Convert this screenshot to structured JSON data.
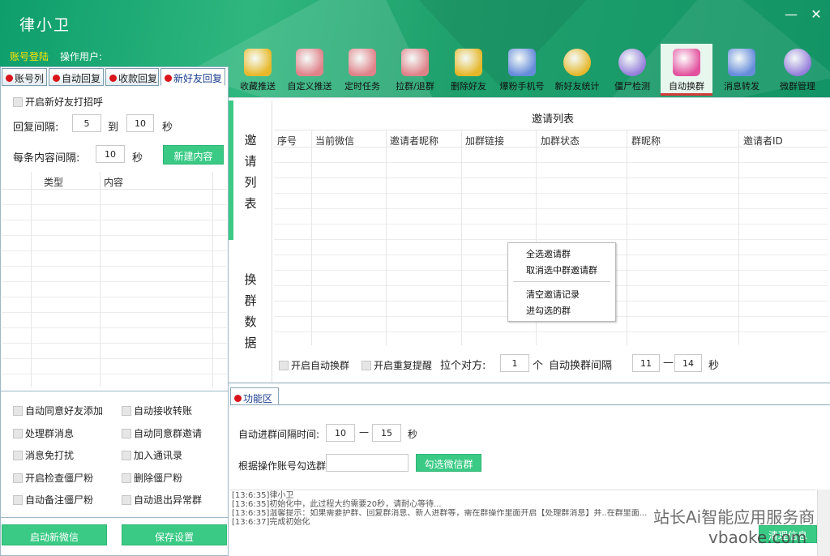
{
  "app": {
    "title": "律小卫",
    "minimize_icon": "minimize-icon",
    "close_icon": "close-icon"
  },
  "header": {
    "login_label": "账号登陆",
    "operator_label": "操作用户:"
  },
  "toolbar": [
    {
      "name": "toolbar-collect-push",
      "label": "收藏推送",
      "icon": "folder-star-icon",
      "color": "#f0b826"
    },
    {
      "name": "toolbar-custom-push",
      "label": "自定义推送",
      "icon": "document-icon",
      "color": "#e8808a"
    },
    {
      "name": "toolbar-scheduled-task",
      "label": "定时任务",
      "icon": "cup-icon",
      "color": "#e8808a"
    },
    {
      "name": "toolbar-pull-group",
      "label": "拉群/退群",
      "icon": "bell-icon",
      "color": "#e8808a"
    },
    {
      "name": "toolbar-delete-friend",
      "label": "删除好友",
      "icon": "trash-icon",
      "color": "#f0b826"
    },
    {
      "name": "toolbar-follower-phone",
      "label": "爆粉手机号",
      "icon": "phone-icon",
      "color": "#6a8be0"
    },
    {
      "name": "toolbar-new-friend-stats",
      "label": "新好友统计",
      "icon": "user-icon",
      "color": "#f0b826"
    },
    {
      "name": "toolbar-zombie-detect",
      "label": "僵尸检测",
      "icon": "search-icon",
      "color": "#9a7be0"
    },
    {
      "name": "toolbar-auto-swap-group",
      "label": "自动换群",
      "icon": "monitor-icon",
      "color": "#e14a9a",
      "active": true
    },
    {
      "name": "toolbar-message-forward",
      "label": "消息转发",
      "icon": "chat-icon",
      "color": "#6a8be0"
    },
    {
      "name": "toolbar-micro-group",
      "label": "微群管理",
      "icon": "gear-icon",
      "color": "#9a7be0"
    }
  ],
  "left": {
    "tabs": [
      "账号列",
      "自动回复",
      "收款回复",
      "新好友回复"
    ],
    "greet_checkbox": "开启新好友打招呼",
    "reply_interval_label": "回复间隔:",
    "reply_from": "5",
    "to_label": "到",
    "reply_to": "10",
    "sec_label": "秒",
    "content_interval_label": "每条内容间隔:",
    "content_interval": "10",
    "new_content_button": "新建内容",
    "grid_headers": [
      "类型",
      "内容"
    ],
    "options": [
      [
        "自动同意好友添加",
        "自动接收转账"
      ],
      [
        "处理群消息",
        "自动同意群邀请"
      ],
      [
        "消息免打扰",
        "加入通讯录"
      ],
      [
        "开启检查僵尸粉",
        "删除僵尸粉"
      ],
      [
        "自动备注僵尸粉",
        "自动退出异常群"
      ]
    ],
    "start_button": "启动新微信",
    "save_button": "保存设置"
  },
  "main": {
    "side_label_1": [
      "邀",
      "请",
      "列",
      "表"
    ],
    "side_label_2": [
      "换",
      "群",
      "数",
      "据"
    ],
    "list_title": "邀请列表",
    "columns": [
      "序号",
      "当前微信",
      "邀请者昵称",
      "加群链接",
      "加群状态",
      "群昵称",
      "邀请者ID"
    ],
    "context_menu": [
      "全选邀请群",
      "取消选中群邀请群",
      "清空邀请记录",
      "进勾选的群"
    ],
    "auto_swap_checkbox": "开启自动换群",
    "repeat_remind_checkbox": "开启重复提醒",
    "pull_label": "拉个对方:",
    "pull_count": "1",
    "pull_unit": "个",
    "interval_label": "自动换群间隔",
    "interval_from": "11",
    "dash": "—",
    "interval_to": "14",
    "sec": "秒"
  },
  "function_area": {
    "tab_label": "功能区",
    "join_interval_label": "自动进群间隔时间:",
    "join_from": "10",
    "dash": "—",
    "join_to": "15",
    "sec": "秒",
    "select_by_account_label": "根据操作账号勾选群",
    "select_input": "",
    "select_button": "勾选微信群"
  },
  "log": {
    "lines": [
      "[13:6:35]律小卫",
      "[13:6:35]初始化中，此过程大约需要20秒，请耐心等待...",
      "[13:6:35]温馨提示：如果需要护群、回复群消息、新人进群等，需在群操作里面开启【处理群消息】并..在群里面...",
      "[13:6:37]完成初始化"
    ],
    "clear_button": "清理信息"
  },
  "watermark": {
    "line1": "站长Ai智能应用服务商",
    "line2": "vbaoke.com"
  }
}
